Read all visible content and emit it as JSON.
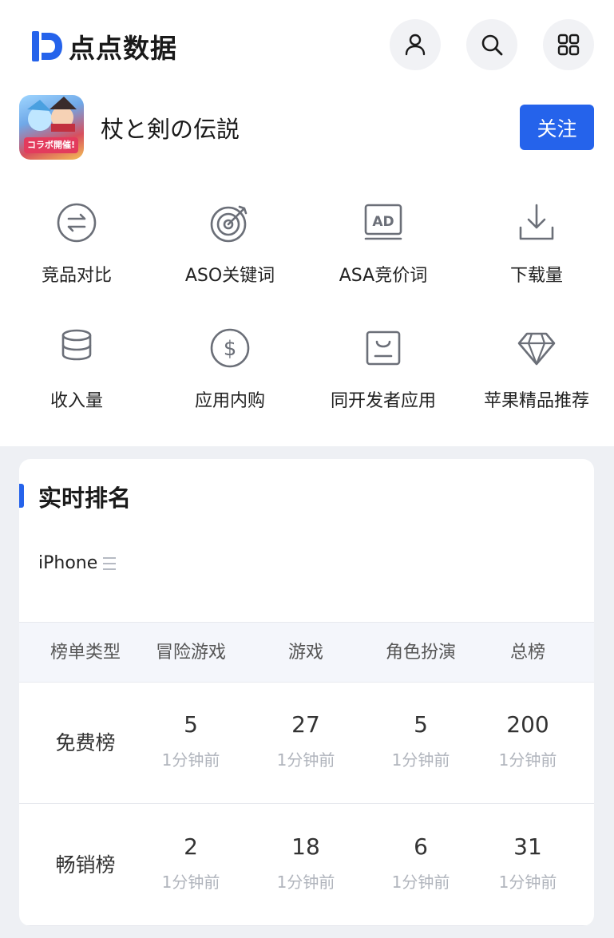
{
  "brand": {
    "name": "点点数据",
    "accent": "#2563eb"
  },
  "topbar": {
    "icons": [
      "user-icon",
      "search-icon",
      "grid-menu-icon"
    ]
  },
  "app": {
    "name": "杖と剣の伝説",
    "icon_badge": "コラボ開催!",
    "follow_label": "关注"
  },
  "features": [
    {
      "label": "竞品对比",
      "icon": "compare-icon"
    },
    {
      "label": "ASO关键词",
      "icon": "target-icon"
    },
    {
      "label": "ASA竞价词",
      "icon": "ad-icon"
    },
    {
      "label": "下载量",
      "icon": "download-icon"
    },
    {
      "label": "收入量",
      "icon": "coins-icon"
    },
    {
      "label": "应用内购",
      "icon": "dollar-icon"
    },
    {
      "label": "同开发者应用",
      "icon": "bag-icon"
    },
    {
      "label": "苹果精品推荐",
      "icon": "diamond-icon"
    }
  ],
  "ranking": {
    "title": "实时排名",
    "device": "iPhone",
    "headers": [
      "榜单类型",
      "冒险游戏",
      "游戏",
      "角色扮演",
      "总榜"
    ],
    "rows": [
      {
        "label": "免费榜",
        "cells": [
          {
            "rank": "5",
            "time": "1分钟前"
          },
          {
            "rank": "27",
            "time": "1分钟前"
          },
          {
            "rank": "5",
            "time": "1分钟前"
          },
          {
            "rank": "200",
            "time": "1分钟前"
          }
        ]
      },
      {
        "label": "畅销榜",
        "cells": [
          {
            "rank": "2",
            "time": "1分钟前"
          },
          {
            "rank": "18",
            "time": "1分钟前"
          },
          {
            "rank": "6",
            "time": "1分钟前"
          },
          {
            "rank": "31",
            "time": "1分钟前"
          }
        ]
      }
    ]
  }
}
